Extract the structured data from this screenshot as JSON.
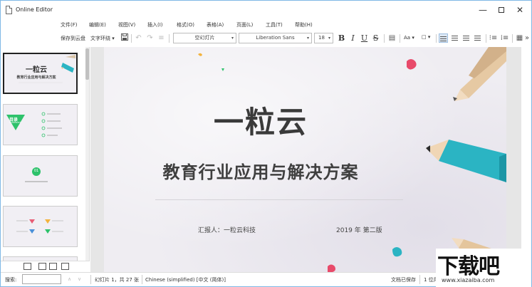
{
  "window": {
    "title": "Online Editor",
    "controls": {
      "minimize": "—",
      "close": "✕"
    }
  },
  "menu": [
    "文件(F)",
    "编辑(E)",
    "视图(V)",
    "插入(I)",
    "格式(O)",
    "表格(A)",
    "页面(L)",
    "工具(T)",
    "帮助(H)"
  ],
  "toolbar": {
    "save_cloud": "保存到云盘",
    "text_wrap": "文字环绕",
    "layout_select": "空幻灯片",
    "font_select": "Liberation Sans",
    "font_size": "18",
    "bold": "B",
    "italic": "I",
    "underline": "U",
    "strike": "S",
    "case": "Aa",
    "dropdown_caret": "▾"
  },
  "slides_panel": {
    "thumb1": {
      "title": "一粒云",
      "subtitle": "教育行业应用与解决方案"
    },
    "thumb2": {
      "heading": "目录",
      "heading_en": "CONTENTS",
      "items": [
        "•",
        "•",
        "•",
        "•"
      ]
    },
    "thumb3": {
      "badge": "01",
      "caption": ""
    }
  },
  "slide": {
    "title": "一粒云",
    "subtitle": "教育行业应用与解决方案",
    "reporter": "汇报人：一粒云科技",
    "year": "2019 年 第二版"
  },
  "statusbar": {
    "search_label": "搜索:",
    "slide_info": "幻灯片 1，共 27 张",
    "language": "Chinese (simplified) [中文 (简体)]",
    "save_state": "文档已保存",
    "zoom_partial": "1 位用"
  },
  "watermark": {
    "big": "下载吧",
    "small": "www.xiazaiba.com"
  },
  "colors": {
    "window_border": "#7fb8e6",
    "slide_bg": "#efedf2",
    "teal_pencil": "#2bb4c3",
    "green_accent": "#2ec26b"
  }
}
